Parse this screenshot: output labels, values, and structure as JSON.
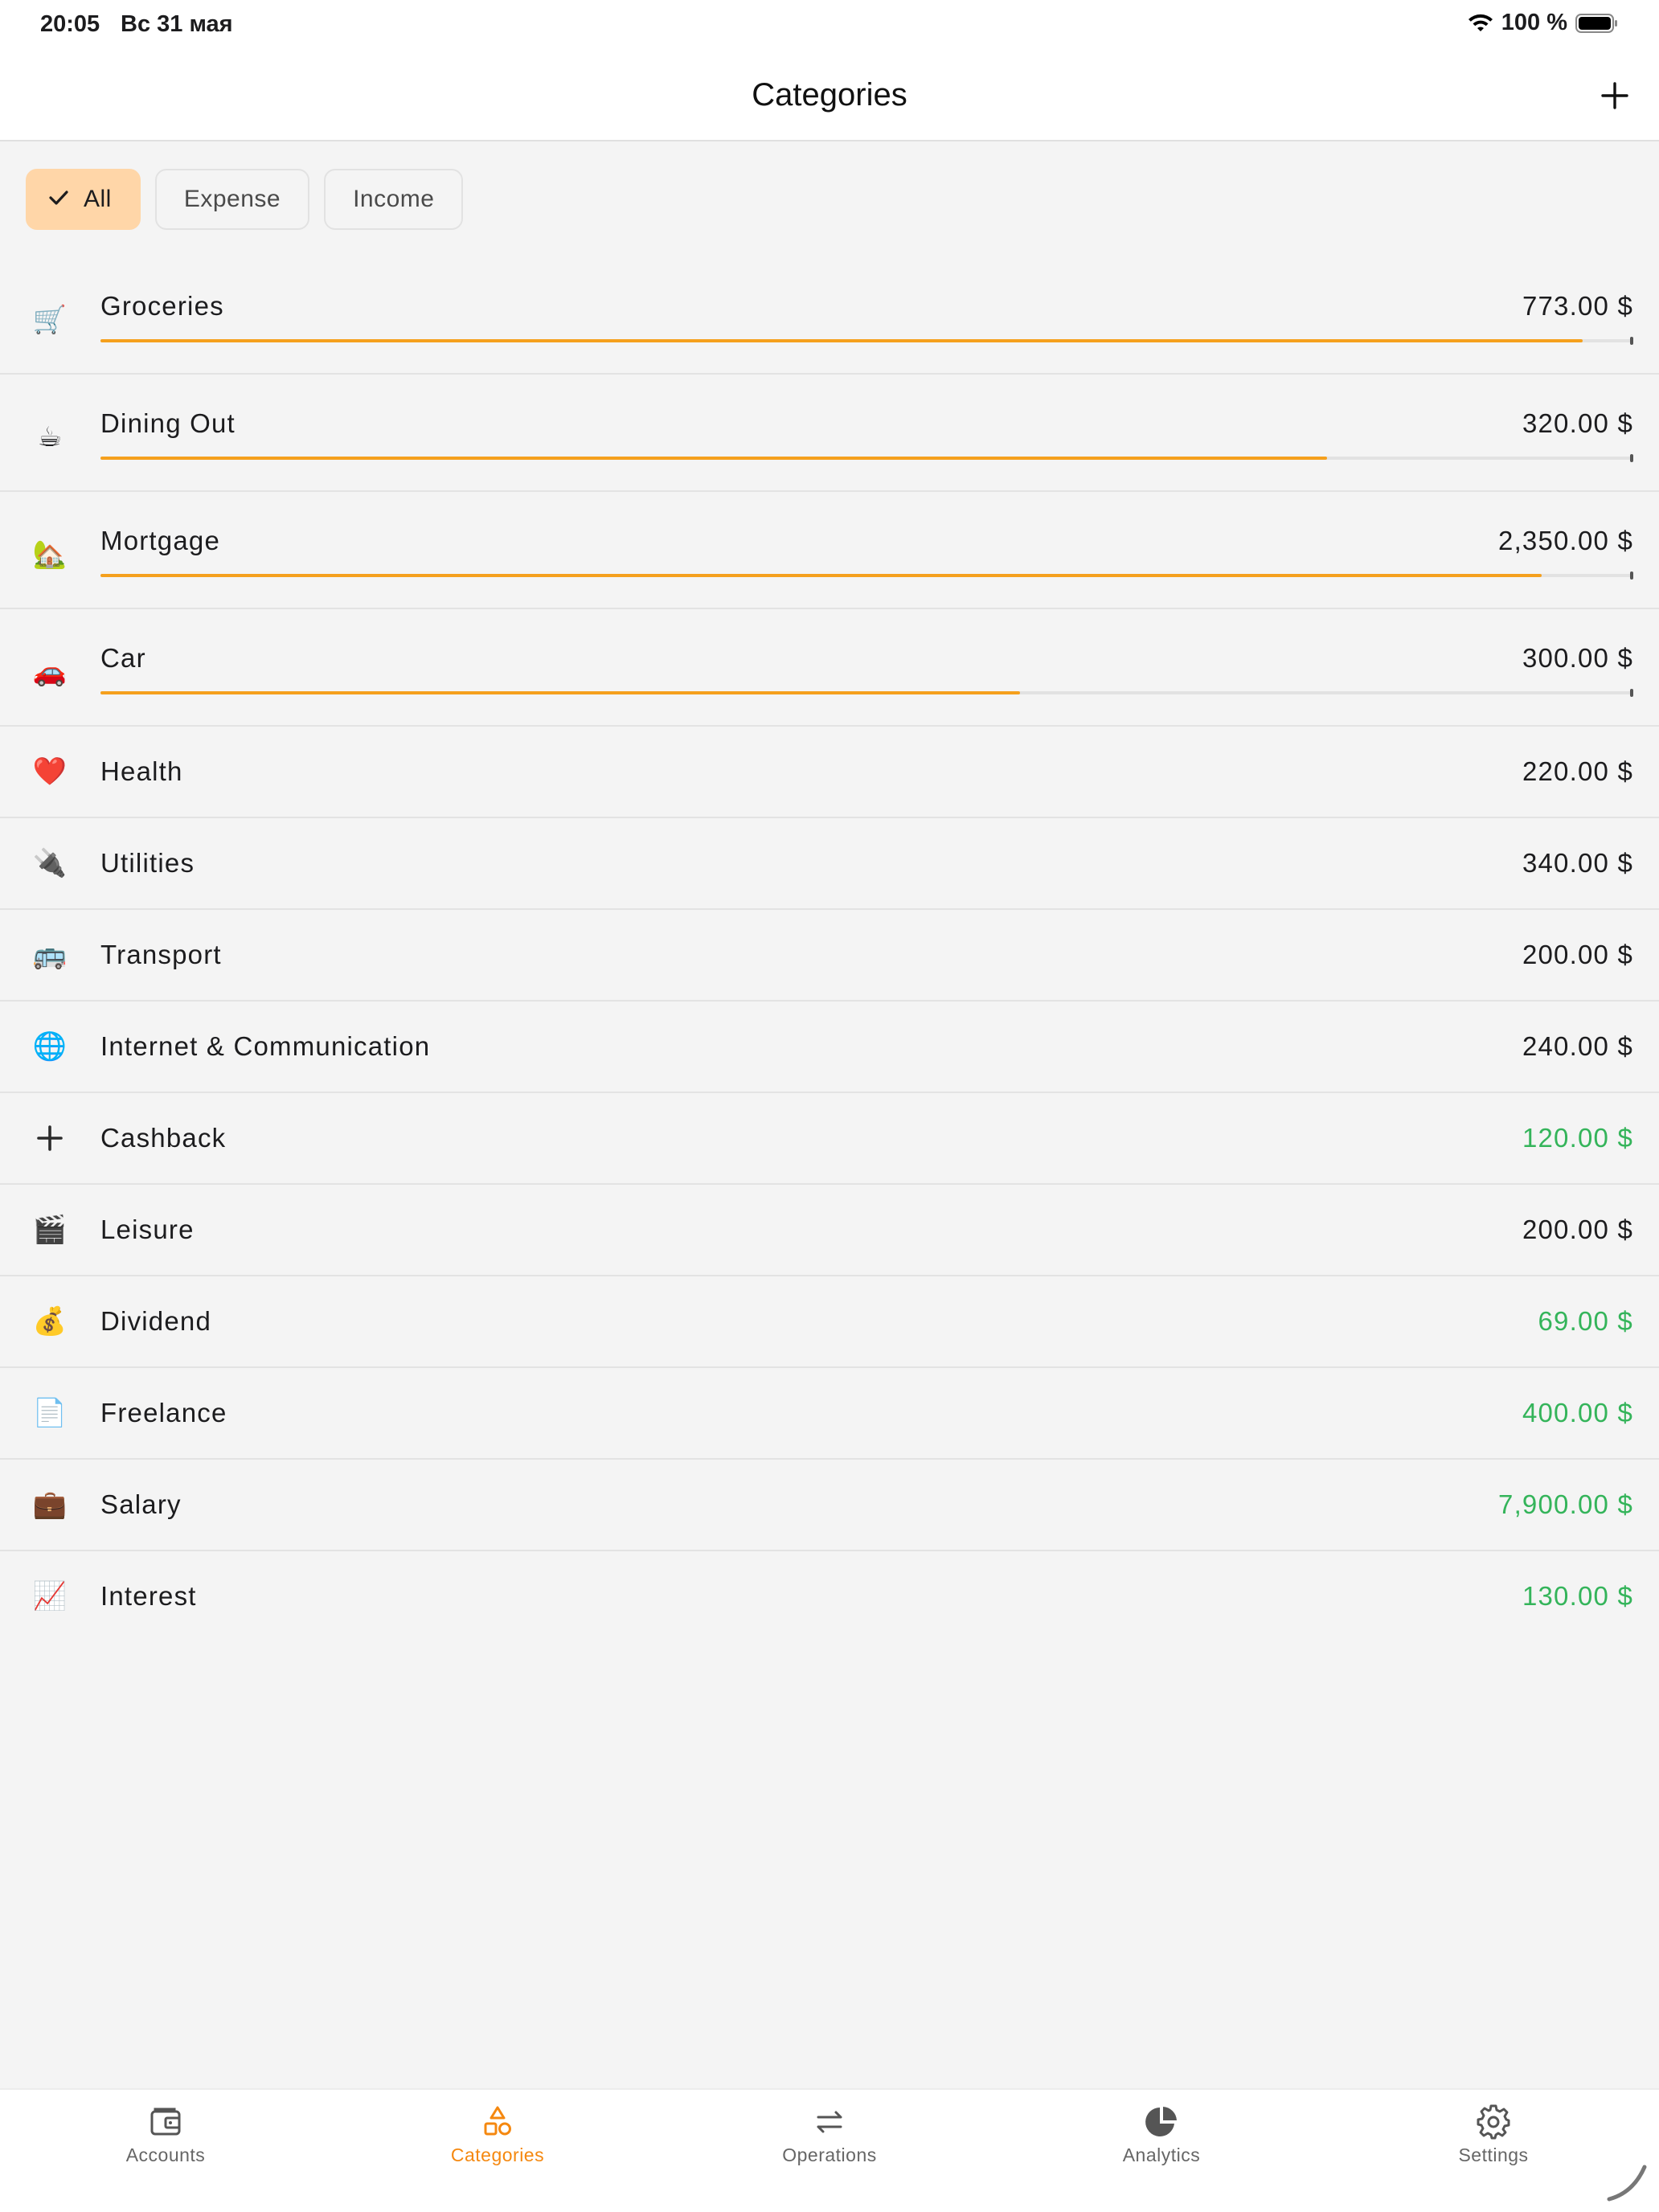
{
  "status_bar": {
    "time": "20:05",
    "date": "Вс 31 мая",
    "battery": "100 %"
  },
  "nav": {
    "title": "Categories",
    "add_icon": "plus-icon"
  },
  "filters": [
    {
      "label": "All",
      "selected": true,
      "icon": "checkmark-icon"
    },
    {
      "label": "Expense",
      "selected": false
    },
    {
      "label": "Income",
      "selected": false
    }
  ],
  "categories": [
    {
      "name": "Groceries",
      "amount": "773.00 $",
      "type": "expense",
      "icon": "shopping-cart-icon",
      "glyph": "🛒",
      "progress": 0.967
    },
    {
      "name": "Dining Out",
      "amount": "320.00 $",
      "type": "expense",
      "icon": "hot-drink-icon",
      "glyph": "☕",
      "progress": 0.8
    },
    {
      "name": "Mortgage",
      "amount": "2,350.00 $",
      "type": "expense",
      "icon": "house-icon",
      "glyph": "🏡",
      "progress": 0.94
    },
    {
      "name": "Car",
      "amount": "300.00 $",
      "type": "expense",
      "icon": "car-icon",
      "glyph": "🚗",
      "progress": 0.6
    },
    {
      "name": "Health",
      "amount": "220.00 $",
      "type": "expense",
      "icon": "heart-icon",
      "glyph": "❤️"
    },
    {
      "name": "Utilities",
      "amount": "340.00 $",
      "type": "expense",
      "icon": "plug-icon",
      "glyph": "🔌"
    },
    {
      "name": "Transport",
      "amount": "200.00 $",
      "type": "expense",
      "icon": "bus-icon",
      "glyph": "🚌"
    },
    {
      "name": "Internet & Communication",
      "amount": "240.00 $",
      "type": "expense",
      "icon": "globe-icon",
      "glyph": "🌐"
    },
    {
      "name": "Cashback",
      "amount": "120.00 $",
      "type": "income",
      "icon": "plus-icon",
      "glyph": "+"
    },
    {
      "name": "Leisure",
      "amount": "200.00 $",
      "type": "expense",
      "icon": "clapperboard-icon",
      "glyph": "🎬"
    },
    {
      "name": "Dividend",
      "amount": "69.00 $",
      "type": "income",
      "icon": "coins-folder-icon",
      "glyph": "💰"
    },
    {
      "name": "Freelance",
      "amount": "400.00 $",
      "type": "income",
      "icon": "document-icon",
      "glyph": "📄"
    },
    {
      "name": "Salary",
      "amount": "7,900.00 $",
      "type": "income",
      "icon": "briefcase-icon",
      "glyph": "💼"
    },
    {
      "name": "Interest",
      "amount": "130.00 $",
      "type": "income",
      "icon": "chart-up-icon",
      "glyph": "📈"
    }
  ],
  "colors": {
    "accent": "#f5880f",
    "progress": "#f5a01d",
    "income": "#34b45a",
    "chip_active": "#ffd6a8"
  },
  "tabs": [
    {
      "label": "Accounts",
      "icon": "wallet-icon",
      "active": false
    },
    {
      "label": "Categories",
      "icon": "shapes-icon",
      "active": true
    },
    {
      "label": "Operations",
      "icon": "arrows-swap-icon",
      "active": false
    },
    {
      "label": "Analytics",
      "icon": "pie-chart-icon",
      "active": false
    },
    {
      "label": "Settings",
      "icon": "gear-icon",
      "active": false
    }
  ]
}
